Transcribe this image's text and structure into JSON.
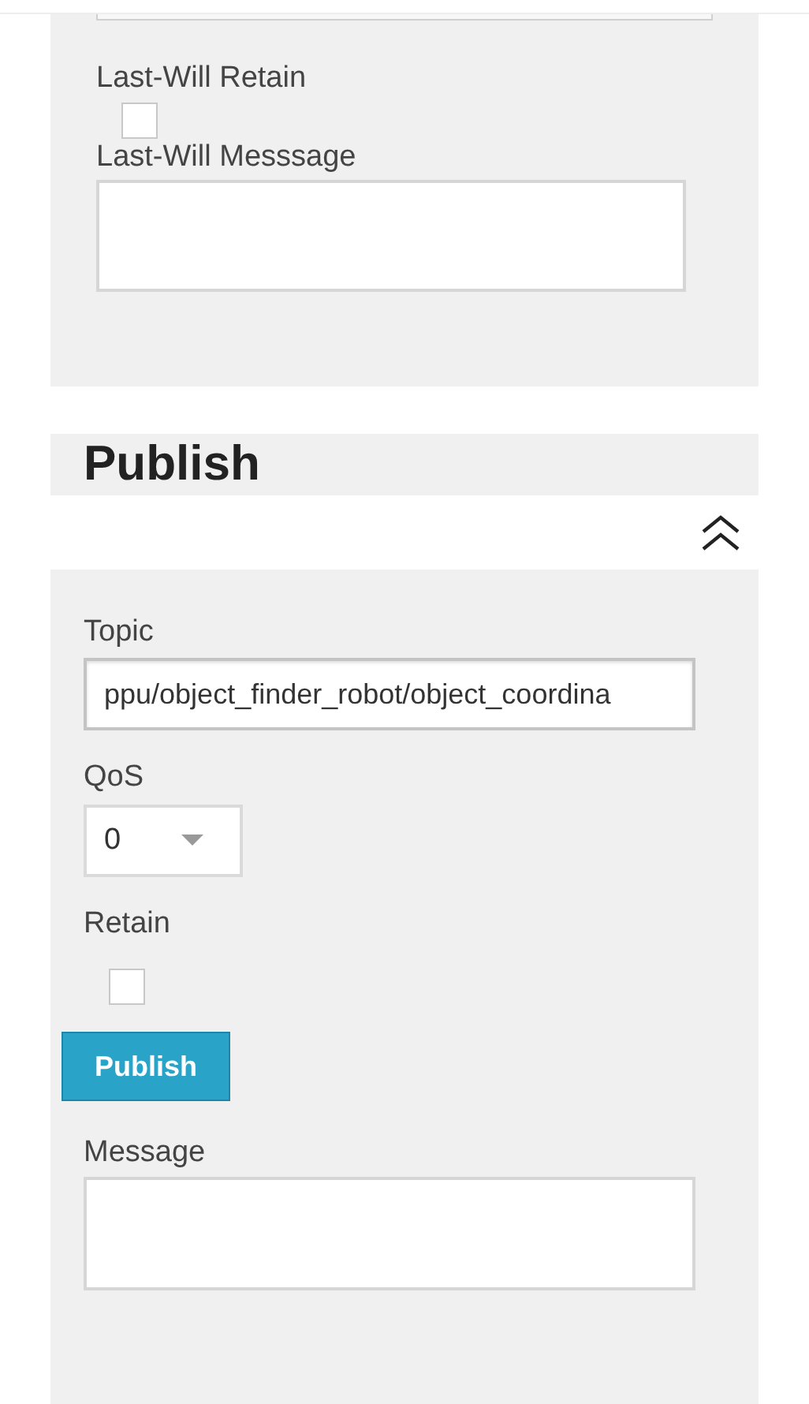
{
  "last_will": {
    "retain_label": "Last-Will Retain",
    "retain_checked": false,
    "message_label": "Last-Will Messsage"
  },
  "publish": {
    "title": "Publish",
    "expanded": true,
    "topic_label": "Topic",
    "topic_value": "ppu/object_finder_robot/object_coordina",
    "qos_label": "QoS",
    "qos_value": "0",
    "retain_label": "Retain",
    "retain_checked": false,
    "button": "Publish",
    "message_label": "Message"
  }
}
